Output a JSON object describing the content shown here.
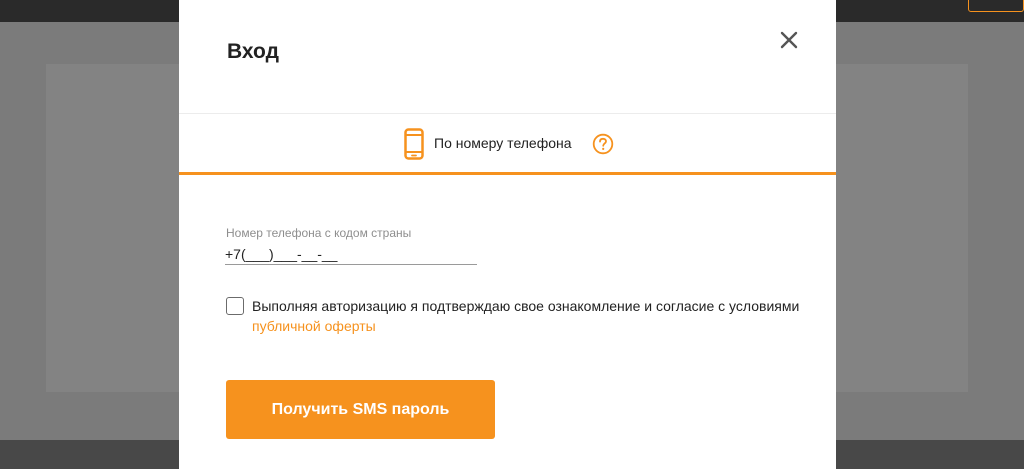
{
  "modal": {
    "title": "Вход",
    "close_icon": "close-icon"
  },
  "tab": {
    "label": "По номеру телефона",
    "icon": "phone-icon",
    "help_icon": "help-icon"
  },
  "phone": {
    "label": "Номер телефона с кодом страны",
    "value": "+7(___)___-__-__"
  },
  "consent": {
    "text": "Выполняя авторизацию я подтверждаю свое ознакомление и согласие с условиями",
    "link": "публичной оферты",
    "checked": false
  },
  "submit": {
    "label": "Получить SMS пароль"
  },
  "colors": {
    "accent": "#f6921e",
    "overlay": "#7b7b7b",
    "text": "#222222"
  }
}
